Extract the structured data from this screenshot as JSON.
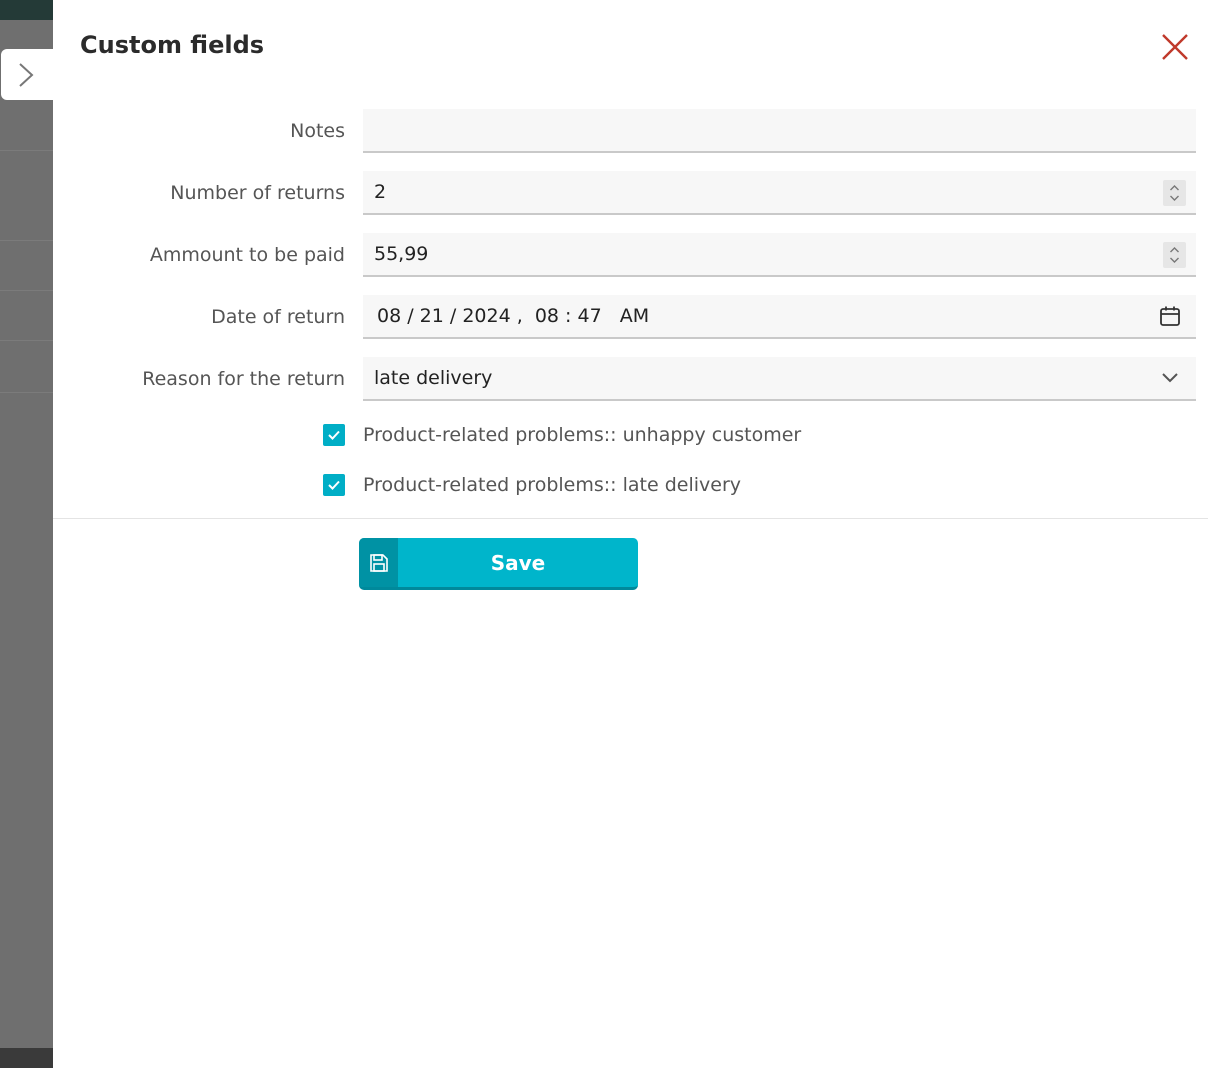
{
  "dialog": {
    "title": "Custom fields",
    "save_label": "Save"
  },
  "fields": {
    "notes": {
      "label": "Notes",
      "value": ""
    },
    "returns": {
      "label": "Number of returns",
      "value": "2"
    },
    "amount": {
      "label": "Ammount to be paid",
      "value": "55,99"
    },
    "date": {
      "label": "Date of return",
      "value": "08 / 21 / 2024 ,  08 : 47   AM"
    },
    "reason": {
      "label": "Reason for the return",
      "value": "late delivery"
    }
  },
  "checkboxes": [
    {
      "label": "Product-related problems:: unhappy customer",
      "checked": true
    },
    {
      "label": "Product-related problems:: late delivery",
      "checked": true
    }
  ],
  "colors": {
    "accent": "#00b5cb",
    "accent_dark": "#0092a4",
    "close": "#c0392b"
  },
  "icons": {
    "expand": "chevron-right-icon",
    "close": "close-icon",
    "calendar": "calendar-icon",
    "dropdown": "chevron-down-icon",
    "save": "floppy-disk-icon"
  }
}
